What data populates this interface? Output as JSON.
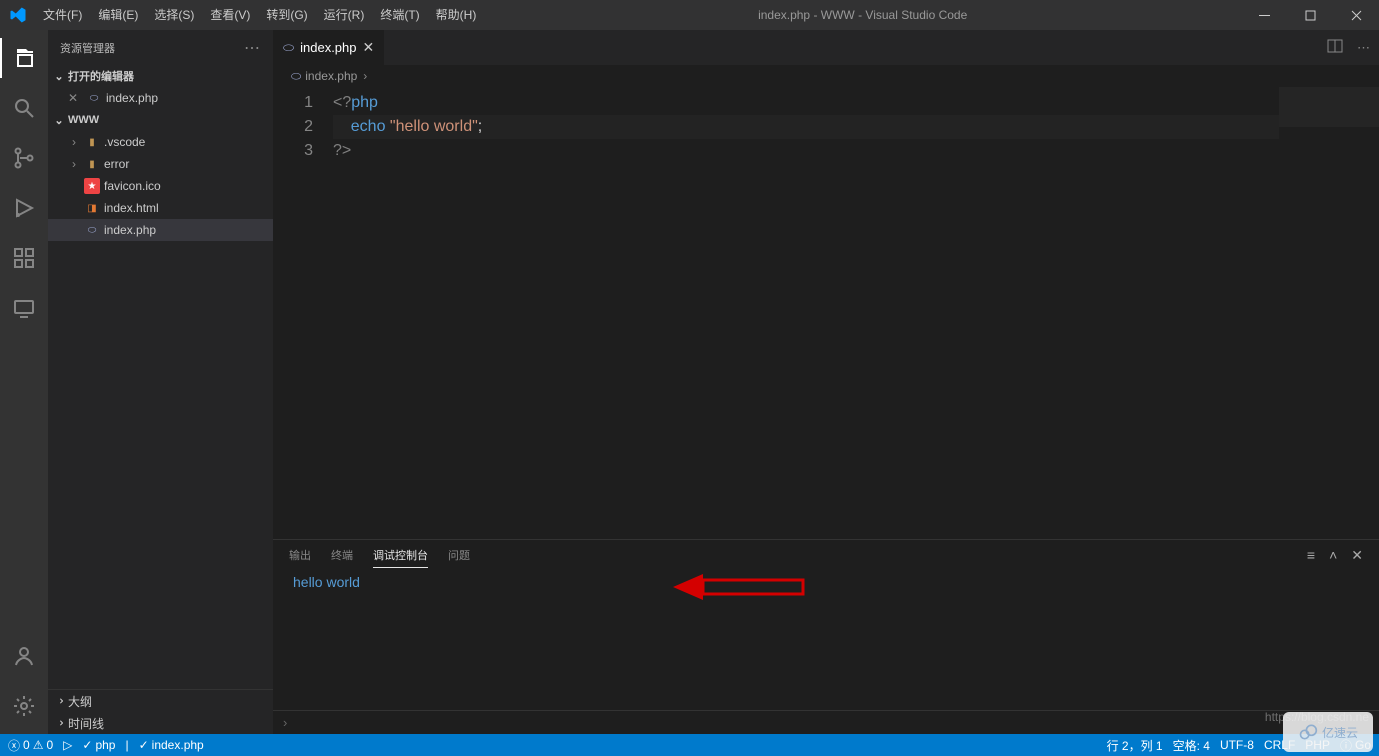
{
  "titlebar": {
    "menus": [
      "文件(F)",
      "编辑(E)",
      "选择(S)",
      "查看(V)",
      "转到(G)",
      "运行(R)",
      "终端(T)",
      "帮助(H)"
    ],
    "title": "index.php - WWW - Visual Studio Code"
  },
  "sidebar": {
    "title": "资源管理器",
    "openEditors": "打开的编辑器",
    "projectName": "WWW",
    "openEditorsItems": [
      {
        "icon": "php",
        "name": "index.php",
        "indent": 20,
        "close": true
      }
    ],
    "tree": [
      {
        "icon": "folder",
        "name": ".vscode",
        "indent": 20,
        "twist": "›"
      },
      {
        "icon": "folder",
        "name": "error",
        "indent": 20,
        "twist": "›"
      },
      {
        "icon": "star",
        "name": "favicon.ico",
        "indent": 36
      },
      {
        "icon": "html",
        "name": "index.html",
        "indent": 36
      },
      {
        "icon": "php",
        "name": "index.php",
        "indent": 36,
        "selected": true
      }
    ],
    "outline": "大纲",
    "timeline": "时间线"
  },
  "editor": {
    "tab": {
      "name": "index.php"
    },
    "breadcrumb": "index.php",
    "lines": {
      "l1_open": "<?",
      "l1_php": "php",
      "l2_indent": "    ",
      "l2_echo": "echo ",
      "l2_str": "\"hello world\"",
      "l2_semi": ";",
      "l3_close": "?>"
    }
  },
  "panel": {
    "tabs": [
      "输出",
      "终端",
      "调试控制台",
      "问题"
    ],
    "activeIdx": 2,
    "output": "hello world"
  },
  "status": {
    "errors": "0",
    "warnings": "0",
    "php": "php",
    "file": "index.php",
    "lncol": "行 2，列 1",
    "spaces": "空格: 4",
    "encoding": "UTF-8",
    "eol": "CRLF",
    "lang": "PHP",
    "go": "Go"
  },
  "watermark": "https://blog.csdn.ne",
  "yisu": "亿速云"
}
